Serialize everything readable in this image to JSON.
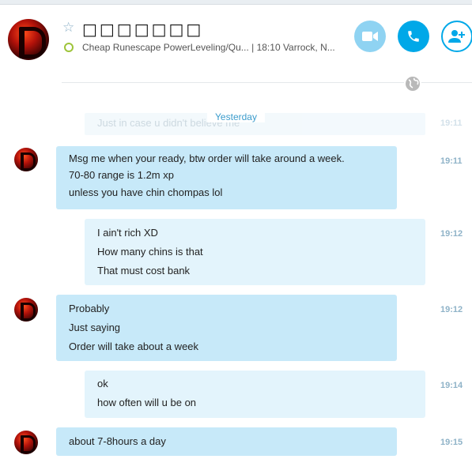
{
  "header": {
    "contact_name": "□□□□□□□",
    "mood_message": "Cheap Runescape PowerLeveling/Qu...  | 18:10 Varrock, N...",
    "status": "online"
  },
  "conversation": {
    "date_separator": "Yesterday",
    "faded_message": {
      "text": "Just in case u didn't believe me",
      "time": "19:11"
    },
    "messages": [
      {
        "direction": "in",
        "time": "19:11",
        "lines": [
          "Msg me when your ready, btw order will take around a week.",
          "70-80 range is 1.2m xp",
          "unless you have chin chompas lol"
        ]
      },
      {
        "direction": "out",
        "time": "19:12",
        "lines": [
          "I ain't rich XD",
          "How many chins is that",
          "That must cost bank"
        ]
      },
      {
        "direction": "in",
        "time": "19:12",
        "lines": [
          "Probably",
          "Just saying",
          "Order will take about a week"
        ]
      },
      {
        "direction": "out",
        "time": "19:14",
        "lines": [
          "ok",
          "how often will u be on"
        ]
      },
      {
        "direction": "in",
        "time": "19:15",
        "lines": [
          "about 7-8hours a day"
        ]
      }
    ]
  },
  "colors": {
    "accent": "#00a8e8",
    "incoming_bubble": "#c7e9f9",
    "outgoing_bubble": "#e3f4fc",
    "presence": "#9ec43a"
  },
  "icons": [
    "star-icon",
    "video-icon",
    "phone-icon",
    "add-contact-icon",
    "globe-icon"
  ]
}
